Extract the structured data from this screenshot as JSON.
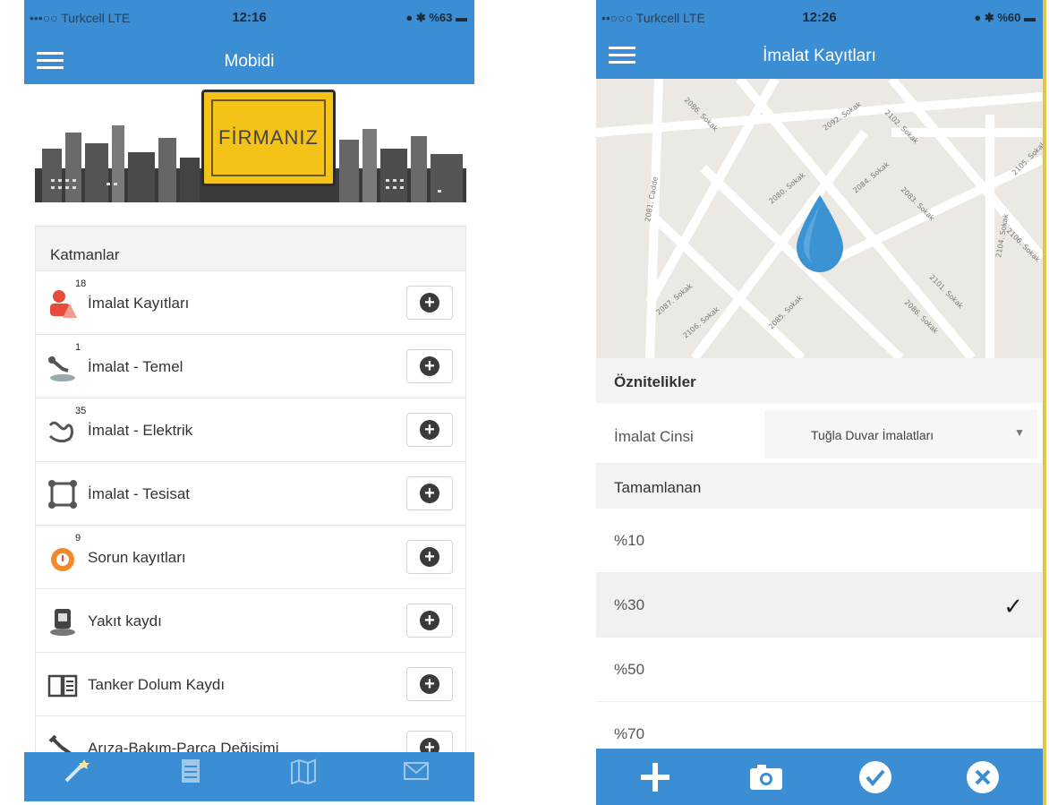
{
  "left": {
    "status": {
      "carrier": "•••○○ Turkcell  LTE",
      "time": "12:16",
      "battery": "● ✱ %63 ▬"
    },
    "app_title": "Mobidi",
    "banner_text": "FİRMANIZ",
    "layers_title": "Katmanlar",
    "layers": [
      {
        "label": "İmalat Kayıtları",
        "count": "18",
        "icon": "worker-warning-icon"
      },
      {
        "label": "İmalat - Temel",
        "count": "1",
        "icon": "excavator-icon"
      },
      {
        "label": "İmalat - Elektrik",
        "count": "35",
        "icon": "cable-icon"
      },
      {
        "label": "İmalat - Tesisat",
        "count": "",
        "icon": "pipes-icon"
      },
      {
        "label": "Sorun kayıtları",
        "count": "9",
        "icon": "alarm-icon"
      },
      {
        "label": "Yakıt kaydı",
        "count": "",
        "icon": "fuel-pump-icon"
      },
      {
        "label": "Tanker Dolum Kaydı",
        "count": "",
        "icon": "book-icon"
      },
      {
        "label": "Arıza-Bakım-Parça Değişimi",
        "count": "",
        "icon": "wrench-icon"
      }
    ],
    "tabs": [
      {
        "icon": "magic-wand-icon"
      },
      {
        "icon": "list-icon"
      },
      {
        "icon": "map-icon"
      },
      {
        "icon": "mail-icon"
      }
    ]
  },
  "right": {
    "status": {
      "carrier": "••○○○ Turkcell  LTE",
      "time": "12:26",
      "battery": "● ✱ %60 ▬"
    },
    "app_title": "İmalat Kayıtları",
    "map_streets": [
      "2081. Cadde",
      "2086. Sokak",
      "2092. Sokak",
      "2102. Sokak",
      "2080. Sokak",
      "2083. Sokak",
      "2084. Sokak",
      "2104. Sokak",
      "2105. Sokak",
      "2106. Sokak",
      "2087. Sokak",
      "2101. Sokak",
      "2106. Sokak",
      "2085. Sokak",
      "2086. Sokak"
    ],
    "attributes_title": "Öznitelikler",
    "field_label": "İmalat Cinsi",
    "field_value": "Tuğla Duvar İmalatları",
    "completed_title": "Tamamlanan",
    "options": [
      "%10",
      "%30",
      "%50",
      "%70"
    ],
    "selected_option": "%30",
    "toolbar": [
      "plus-icon",
      "camera-icon",
      "check-circle-icon",
      "close-circle-icon"
    ]
  }
}
